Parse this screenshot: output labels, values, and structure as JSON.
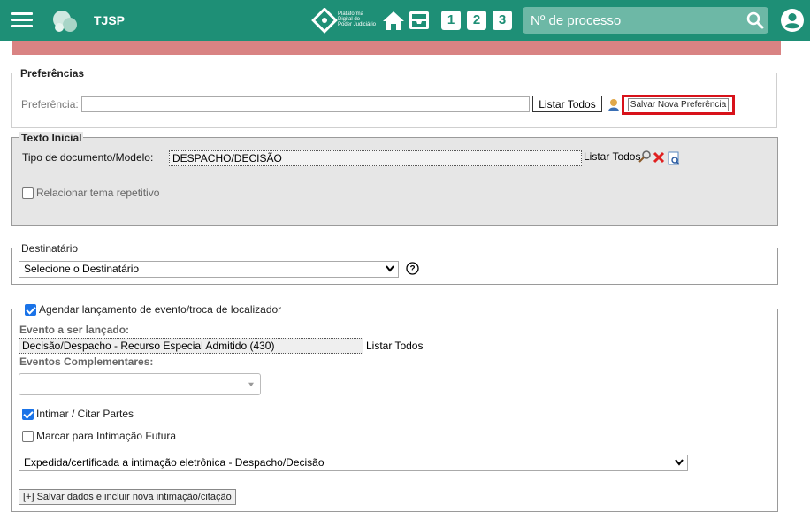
{
  "header": {
    "brand": "TJSP",
    "platform_lines": [
      "Plataforma",
      "Digital do",
      "Poder Judiciário"
    ],
    "numbers": [
      "1",
      "2",
      "3"
    ],
    "search_placeholder": "Nº de processo"
  },
  "preferencias": {
    "legend": "Preferências",
    "label": "Preferência:",
    "input_value": "",
    "listar_todos": "Listar Todos",
    "salvar": "Salvar Nova Preferência"
  },
  "texto_inicial": {
    "legend": "Texto Inicial",
    "tipo_label": "Tipo de documento/Modelo:",
    "tipo_value": "DESPACHO/DECISÃO",
    "listar_todos": "Listar Todos",
    "relacionar": "Relacionar tema repetitivo",
    "relacionar_checked": false
  },
  "destinatario": {
    "legend": "Destinatário",
    "select_value": "Selecione o Destinatário"
  },
  "agendar": {
    "legend": "Agendar lançamento de evento/troca de localizador",
    "legend_checked": true,
    "evento_label": "Evento a ser lançado:",
    "evento_value": "Decisão/Despacho - Recurso Especial Admitido (430)",
    "listar_todos": "Listar Todos",
    "complementares_label": "Eventos Complementares:",
    "complementares_value": "",
    "intimar": "Intimar / Citar Partes",
    "intimar_checked": true,
    "marcar": "Marcar para Intimação Futura",
    "marcar_checked": false,
    "intimacao_select": "Expedida/certificada a intimação eletrônica - Despacho/Decisão",
    "salvar_btn": "[+] Salvar dados e incluir nova intimação/citação"
  },
  "colors": {
    "topbar": "#1e8f76",
    "alert": "#d98383",
    "highlight": "#d8121a"
  }
}
